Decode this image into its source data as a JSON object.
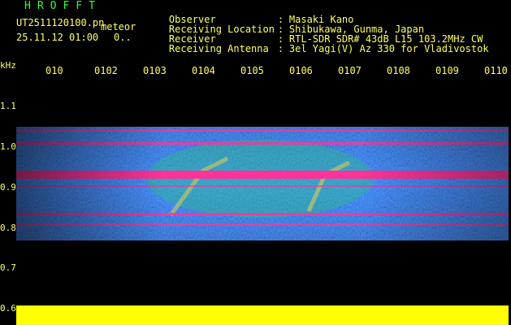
{
  "header": {
    "app_title": "HROFFT",
    "filename": "UT2511120100.pn",
    "meteor_label": "meteor",
    "datetime": "25.11.12 01:00",
    "count": "0..",
    "fields": [
      {
        "label": "Observer",
        "value": "Masaki Kano"
      },
      {
        "label": "Receiving Location",
        "value": "Shibukawa, Gunma, Japan"
      },
      {
        "label": "Receiver",
        "value": "RTL-SDR SDR# 43dB L15 103.2MHz CW"
      },
      {
        "label": "Receiving Antenna",
        "value": "3el Yagi(V) Az 330 for Vladivostok"
      }
    ],
    "separator": ":"
  },
  "axes": {
    "y_unit": "kHz",
    "y_ticks": [
      "1.1",
      "1.0",
      "0.9",
      "0.8",
      "0.7",
      "0.6"
    ],
    "x_ticks": [
      "010",
      "0102",
      "0103",
      "0104",
      "0105",
      "0106",
      "0107",
      "0108",
      "0109",
      "0110"
    ]
  },
  "colors": {
    "background": "#000000",
    "text_yellow": "#ffff66",
    "title_green": "#33ff33",
    "signal_pink": "#ff3399",
    "noise_blue": "#1a3cff",
    "baseline_yellow": "#ffff00"
  }
}
